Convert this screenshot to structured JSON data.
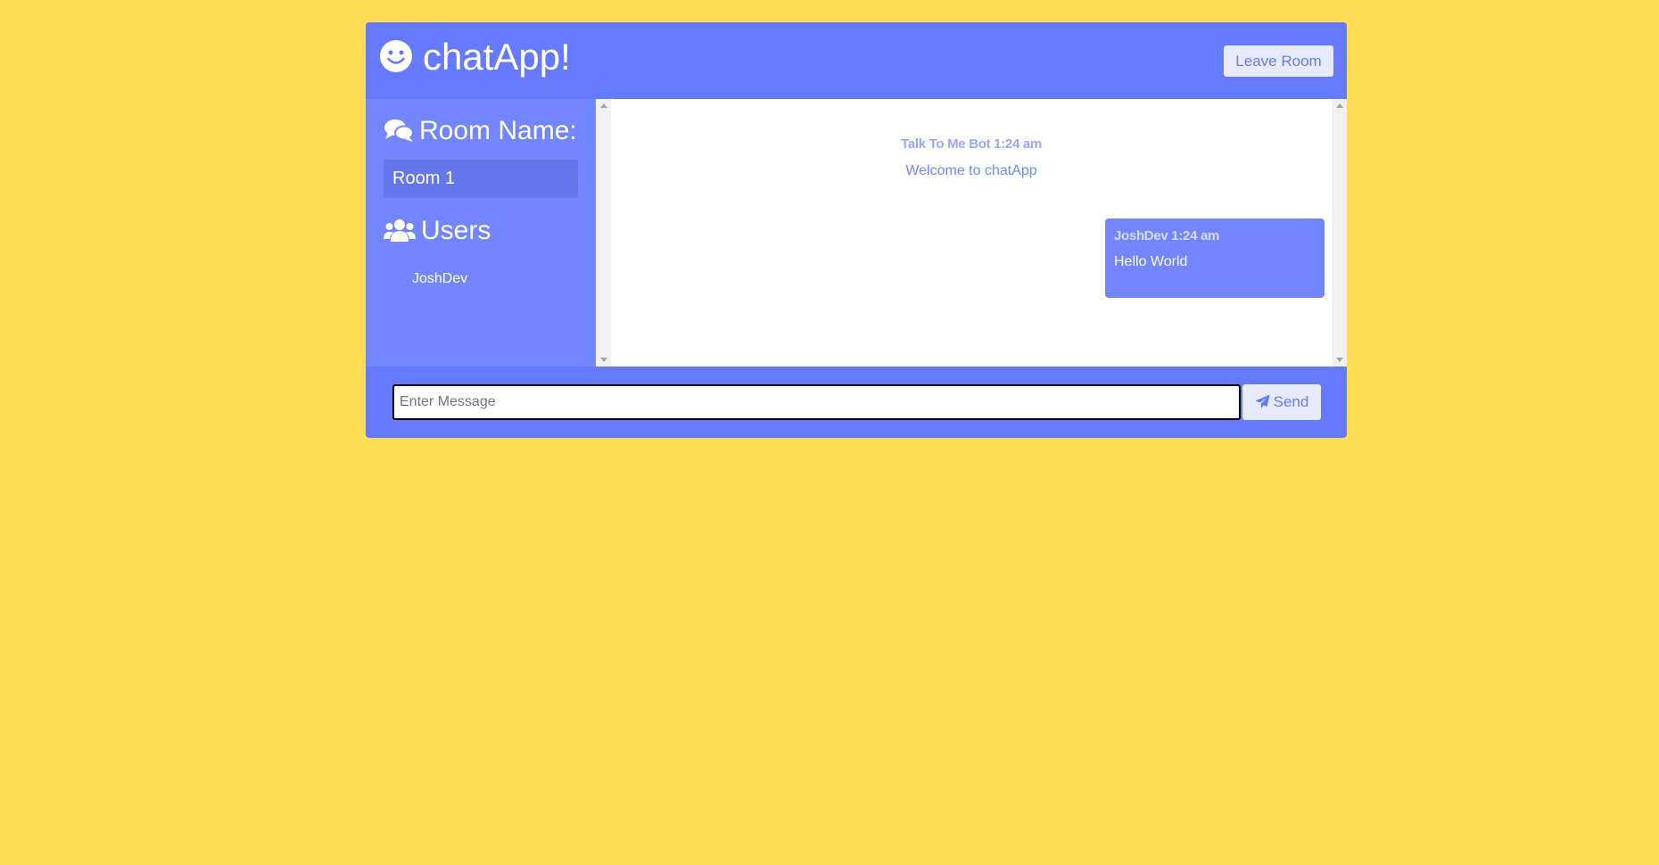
{
  "header": {
    "title": "chatApp!",
    "leave_label": "Leave Room",
    "logo_icon": "smile-icon"
  },
  "sidebar": {
    "room_heading": "Room Name:",
    "room_heading_icon": "comments-icon",
    "room_name": "Room 1",
    "users_heading": "Users",
    "users_heading_icon": "users-icon",
    "users": [
      "JoshDev"
    ]
  },
  "messages": [
    {
      "author": "Talk To Me Bot",
      "time": "1:24 am",
      "meta": "Talk To Me Bot 1:24 am",
      "text": "Welcome to chatApp",
      "type": "bot"
    },
    {
      "author": "JoshDev",
      "time": "1:24 am",
      "meta": "JoshDev 1:24 am",
      "text": "Hello World",
      "type": "user"
    }
  ],
  "composer": {
    "placeholder": "Enter Message",
    "value": "",
    "send_label": "Send",
    "send_icon": "paper-plane-icon"
  },
  "colors": {
    "background": "#ffdd57",
    "primary": "#667aff",
    "sidebar": "#7386ff",
    "room_box": "#6477eb",
    "button_bg": "#e8ebff"
  }
}
